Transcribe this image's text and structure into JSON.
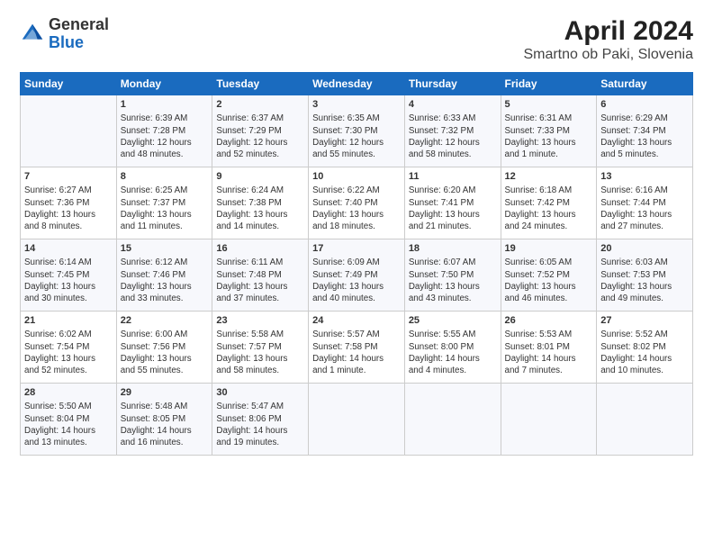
{
  "header": {
    "logo_general": "General",
    "logo_blue": "Blue",
    "title": "April 2024",
    "subtitle": "Smartno ob Paki, Slovenia"
  },
  "days_of_week": [
    "Sunday",
    "Monday",
    "Tuesday",
    "Wednesday",
    "Thursday",
    "Friday",
    "Saturday"
  ],
  "weeks": [
    [
      {
        "day": "",
        "info": ""
      },
      {
        "day": "1",
        "info": "Sunrise: 6:39 AM\nSunset: 7:28 PM\nDaylight: 12 hours\nand 48 minutes."
      },
      {
        "day": "2",
        "info": "Sunrise: 6:37 AM\nSunset: 7:29 PM\nDaylight: 12 hours\nand 52 minutes."
      },
      {
        "day": "3",
        "info": "Sunrise: 6:35 AM\nSunset: 7:30 PM\nDaylight: 12 hours\nand 55 minutes."
      },
      {
        "day": "4",
        "info": "Sunrise: 6:33 AM\nSunset: 7:32 PM\nDaylight: 12 hours\nand 58 minutes."
      },
      {
        "day": "5",
        "info": "Sunrise: 6:31 AM\nSunset: 7:33 PM\nDaylight: 13 hours\nand 1 minute."
      },
      {
        "day": "6",
        "info": "Sunrise: 6:29 AM\nSunset: 7:34 PM\nDaylight: 13 hours\nand 5 minutes."
      }
    ],
    [
      {
        "day": "7",
        "info": "Sunrise: 6:27 AM\nSunset: 7:36 PM\nDaylight: 13 hours\nand 8 minutes."
      },
      {
        "day": "8",
        "info": "Sunrise: 6:25 AM\nSunset: 7:37 PM\nDaylight: 13 hours\nand 11 minutes."
      },
      {
        "day": "9",
        "info": "Sunrise: 6:24 AM\nSunset: 7:38 PM\nDaylight: 13 hours\nand 14 minutes."
      },
      {
        "day": "10",
        "info": "Sunrise: 6:22 AM\nSunset: 7:40 PM\nDaylight: 13 hours\nand 18 minutes."
      },
      {
        "day": "11",
        "info": "Sunrise: 6:20 AM\nSunset: 7:41 PM\nDaylight: 13 hours\nand 21 minutes."
      },
      {
        "day": "12",
        "info": "Sunrise: 6:18 AM\nSunset: 7:42 PM\nDaylight: 13 hours\nand 24 minutes."
      },
      {
        "day": "13",
        "info": "Sunrise: 6:16 AM\nSunset: 7:44 PM\nDaylight: 13 hours\nand 27 minutes."
      }
    ],
    [
      {
        "day": "14",
        "info": "Sunrise: 6:14 AM\nSunset: 7:45 PM\nDaylight: 13 hours\nand 30 minutes."
      },
      {
        "day": "15",
        "info": "Sunrise: 6:12 AM\nSunset: 7:46 PM\nDaylight: 13 hours\nand 33 minutes."
      },
      {
        "day": "16",
        "info": "Sunrise: 6:11 AM\nSunset: 7:48 PM\nDaylight: 13 hours\nand 37 minutes."
      },
      {
        "day": "17",
        "info": "Sunrise: 6:09 AM\nSunset: 7:49 PM\nDaylight: 13 hours\nand 40 minutes."
      },
      {
        "day": "18",
        "info": "Sunrise: 6:07 AM\nSunset: 7:50 PM\nDaylight: 13 hours\nand 43 minutes."
      },
      {
        "day": "19",
        "info": "Sunrise: 6:05 AM\nSunset: 7:52 PM\nDaylight: 13 hours\nand 46 minutes."
      },
      {
        "day": "20",
        "info": "Sunrise: 6:03 AM\nSunset: 7:53 PM\nDaylight: 13 hours\nand 49 minutes."
      }
    ],
    [
      {
        "day": "21",
        "info": "Sunrise: 6:02 AM\nSunset: 7:54 PM\nDaylight: 13 hours\nand 52 minutes."
      },
      {
        "day": "22",
        "info": "Sunrise: 6:00 AM\nSunset: 7:56 PM\nDaylight: 13 hours\nand 55 minutes."
      },
      {
        "day": "23",
        "info": "Sunrise: 5:58 AM\nSunset: 7:57 PM\nDaylight: 13 hours\nand 58 minutes."
      },
      {
        "day": "24",
        "info": "Sunrise: 5:57 AM\nSunset: 7:58 PM\nDaylight: 14 hours\nand 1 minute."
      },
      {
        "day": "25",
        "info": "Sunrise: 5:55 AM\nSunset: 8:00 PM\nDaylight: 14 hours\nand 4 minutes."
      },
      {
        "day": "26",
        "info": "Sunrise: 5:53 AM\nSunset: 8:01 PM\nDaylight: 14 hours\nand 7 minutes."
      },
      {
        "day": "27",
        "info": "Sunrise: 5:52 AM\nSunset: 8:02 PM\nDaylight: 14 hours\nand 10 minutes."
      }
    ],
    [
      {
        "day": "28",
        "info": "Sunrise: 5:50 AM\nSunset: 8:04 PM\nDaylight: 14 hours\nand 13 minutes."
      },
      {
        "day": "29",
        "info": "Sunrise: 5:48 AM\nSunset: 8:05 PM\nDaylight: 14 hours\nand 16 minutes."
      },
      {
        "day": "30",
        "info": "Sunrise: 5:47 AM\nSunset: 8:06 PM\nDaylight: 14 hours\nand 19 minutes."
      },
      {
        "day": "",
        "info": ""
      },
      {
        "day": "",
        "info": ""
      },
      {
        "day": "",
        "info": ""
      },
      {
        "day": "",
        "info": ""
      }
    ]
  ]
}
